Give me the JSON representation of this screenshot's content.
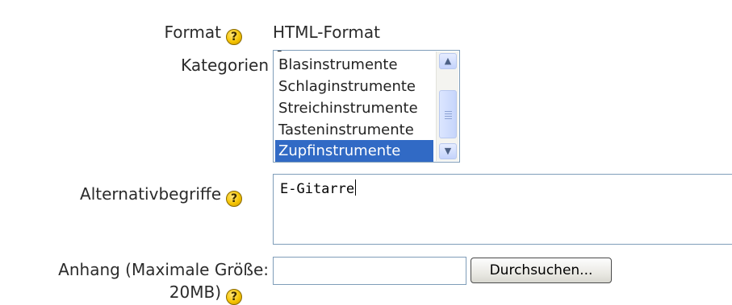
{
  "form": {
    "format": {
      "label": "Format",
      "value": "HTML-Format"
    },
    "categories": {
      "label": "Kategorien",
      "partial_item": "-",
      "options": [
        "Blasinstrumente",
        "Schlaginstrumente",
        "Streichinstrumente",
        "Tasteninstrumente",
        "Zupfinstrumente"
      ],
      "selected": "Zupfinstrumente"
    },
    "alternatives": {
      "label": "Alternativbegriffe",
      "value": "E-Gitarre"
    },
    "attachment": {
      "label_line1": "Anhang (Maximale Größe:",
      "label_line2": "20MB)",
      "value": "",
      "browse_label": "Durchsuchen..."
    }
  },
  "icons": {
    "help": "help-icon",
    "scroll_up": "arrow-up-icon",
    "scroll_down": "arrow-down-icon"
  },
  "colors": {
    "selection": "#316ac5",
    "help_icon": "#f5c400",
    "input_border": "#7f9db9"
  }
}
